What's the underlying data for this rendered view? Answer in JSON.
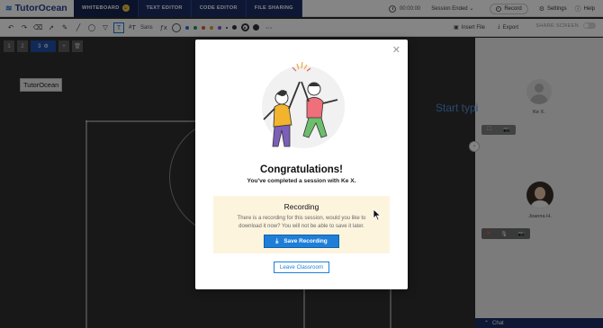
{
  "app": {
    "name": "TutorOcean"
  },
  "tabs": [
    {
      "label": "WHITEBOARD"
    },
    {
      "label": "TEXT EDITOR"
    },
    {
      "label": "CODE EDITOR"
    },
    {
      "label": "FILE SHARING"
    }
  ],
  "header": {
    "timer": "00:00:00",
    "session_status": "Session Ended",
    "record_label": "Record",
    "settings_label": "Settings",
    "help_label": "Help"
  },
  "toolbar": {
    "font_label": "Sans",
    "insert_file_label": "Insert File",
    "export_label": "Export",
    "share_screen_label": "SHARE SCREEN",
    "swatch_colors": [
      "#1f73d8",
      "#2e8b57",
      "#e4542b",
      "#e49a2b",
      "#8a4fd8"
    ]
  },
  "board": {
    "pages": [
      "1",
      "2",
      "3"
    ],
    "current_page": "3",
    "tooltip": "TutorOcean",
    "placeholder": "Start typi"
  },
  "participants": [
    {
      "name": "Ke X."
    },
    {
      "name": "Joanna H."
    }
  ],
  "chat": {
    "label": "Chat"
  },
  "modal": {
    "title": "Congratulations!",
    "subtitle": "You've completed a session with Ke X.",
    "recording_title": "Recording",
    "recording_desc": "There is a recording for this session, would you like to download it now? You will not be able to save it later.",
    "save_button": "Save Recording",
    "leave_button": "Leave Classroom"
  }
}
